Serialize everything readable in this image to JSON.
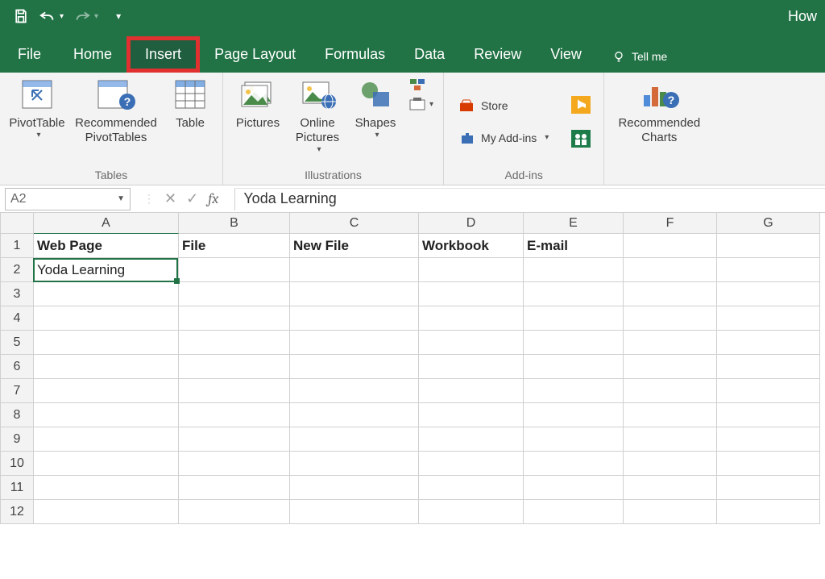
{
  "titlebar": {
    "title_right": "How"
  },
  "tabs": {
    "file": "File",
    "home": "Home",
    "insert": "Insert",
    "page_layout": "Page Layout",
    "formulas": "Formulas",
    "data": "Data",
    "review": "Review",
    "view": "View",
    "tell_me": "Tell me"
  },
  "ribbon": {
    "pivot_table": "PivotTable",
    "recommended_pivot": "Recommended\nPivotTables",
    "table": "Table",
    "tables_group": "Tables",
    "pictures": "Pictures",
    "online_pictures": "Online\nPictures",
    "shapes": "Shapes",
    "illustrations_group": "Illustrations",
    "store": "Store",
    "my_addins": "My Add-ins",
    "addins_group": "Add-ins",
    "recommended_charts": "Recommended\nCharts"
  },
  "namebox": {
    "value": "A2"
  },
  "formula": {
    "value": "Yoda Learning"
  },
  "columns": [
    "A",
    "B",
    "C",
    "D",
    "E",
    "F",
    "G"
  ],
  "rows": [
    "1",
    "2",
    "3",
    "4",
    "5",
    "6",
    "7",
    "8",
    "9",
    "10",
    "11",
    "12"
  ],
  "cells": {
    "A1": "Web Page",
    "B1": "File",
    "C1": "New File",
    "D1": "Workbook",
    "E1": "E-mail",
    "A2": "Yoda Learning"
  },
  "icons": {
    "save": "save-icon",
    "undo": "undo-icon",
    "redo": "redo-icon"
  }
}
